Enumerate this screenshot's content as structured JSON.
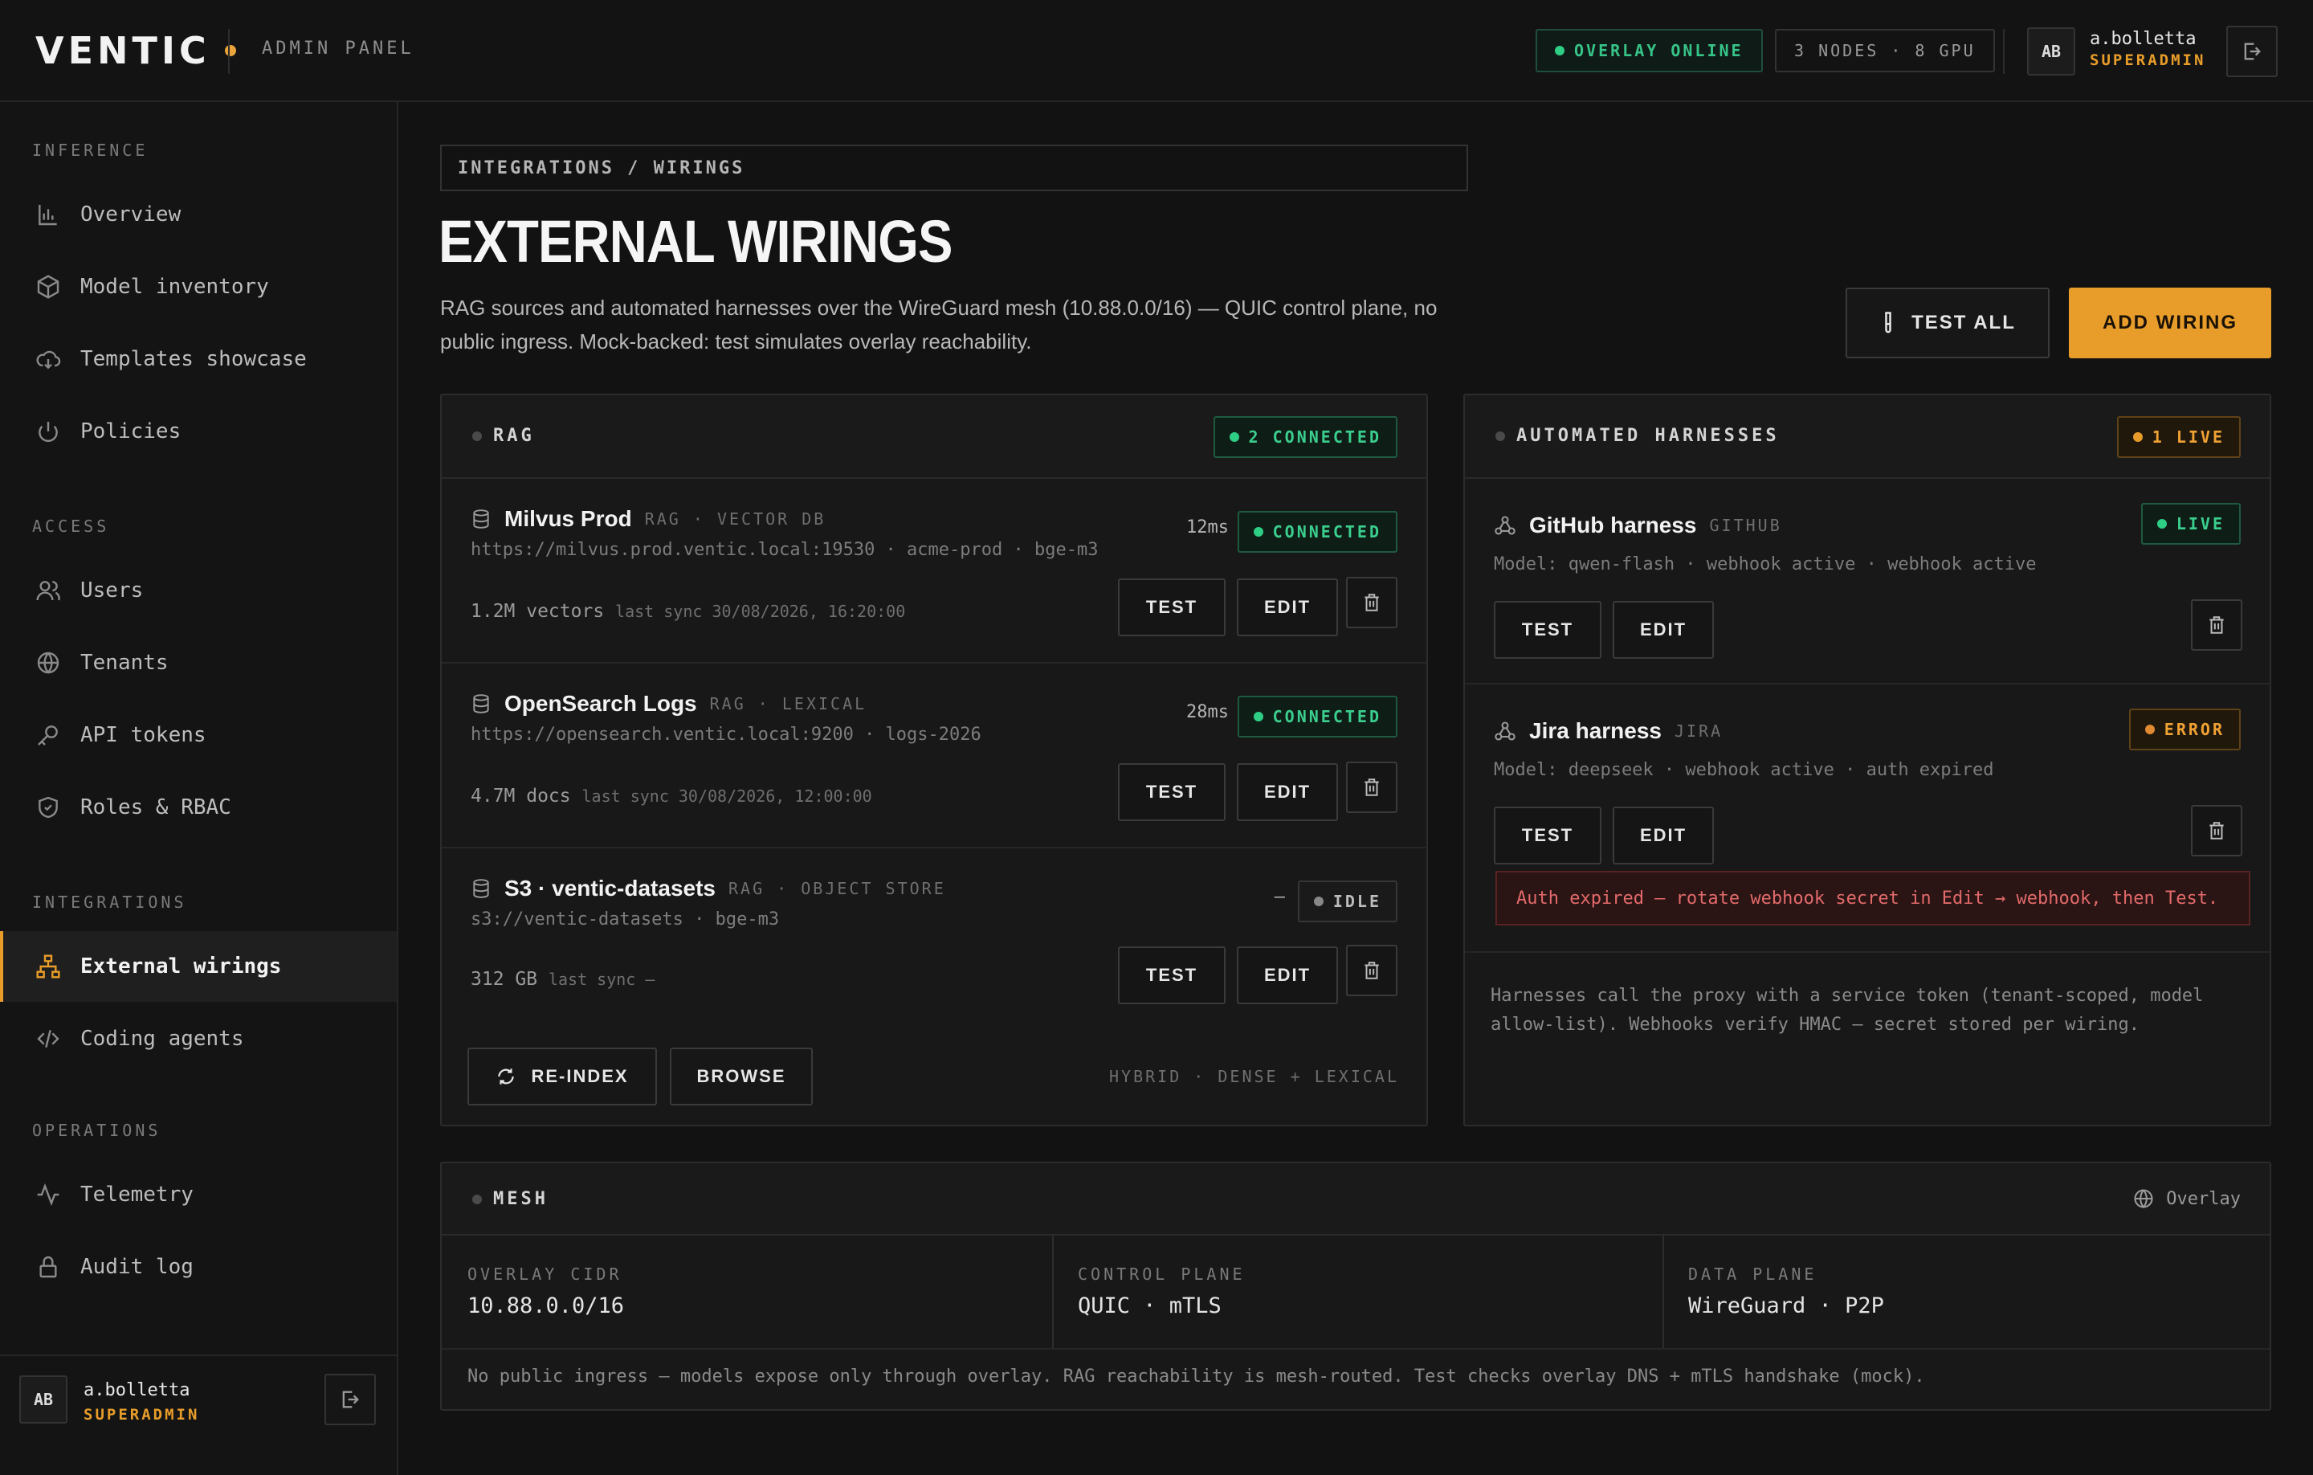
{
  "brand": {
    "logo": "VENTIC",
    "panel_label": "ADMIN PANEL",
    "accent": "#e89d2a",
    "success": "#36c488",
    "error": "#e36a6a"
  },
  "topbar": {
    "overlay_status": "OVERLAY ONLINE",
    "cluster": "3 NODES · 8 GPU",
    "user": {
      "initials": "AB",
      "name": "a.bolletta",
      "role": "SUPERADMIN"
    }
  },
  "sidebar": {
    "sections": [
      {
        "title": "INFERENCE",
        "items": [
          {
            "label": "Overview",
            "icon": "bar-chart-icon"
          },
          {
            "label": "Model inventory",
            "icon": "cube-icon"
          },
          {
            "label": "Templates showcase",
            "icon": "cloud-icon"
          },
          {
            "label": "Policies",
            "icon": "power-icon"
          }
        ]
      },
      {
        "title": "ACCESS",
        "items": [
          {
            "label": "Users",
            "icon": "users-icon"
          },
          {
            "label": "Tenants",
            "icon": "globe-icon"
          },
          {
            "label": "API tokens",
            "icon": "key-icon"
          },
          {
            "label": "Roles & RBAC",
            "icon": "shield-icon"
          }
        ]
      },
      {
        "title": "INTEGRATIONS",
        "items": [
          {
            "label": "External wirings",
            "icon": "network-icon",
            "active": true
          },
          {
            "label": "Coding agents",
            "icon": "code-icon"
          }
        ]
      },
      {
        "title": "OPERATIONS",
        "items": [
          {
            "label": "Telemetry",
            "icon": "pulse-icon"
          },
          {
            "label": "Audit log",
            "icon": "lock-icon"
          }
        ]
      }
    ],
    "footer": {
      "initials": "AB",
      "name": "a.bolletta",
      "role": "SUPERADMIN"
    }
  },
  "page": {
    "breadcrumb": "INTEGRATIONS / WIRINGS",
    "title": "EXTERNAL WIRINGS",
    "description": "RAG sources and automated harnesses over the WireGuard mesh (10.88.0.0/16) — QUIC control plane, no public ingress. Mock-backed: test simulates overlay reachability.",
    "test_all": "TEST ALL",
    "add_wiring": "ADD WIRING"
  },
  "rag": {
    "title": "RAG",
    "status": "2 CONNECTED",
    "test": "TEST",
    "edit": "EDIT",
    "items": [
      {
        "name": "Milvus Prod",
        "tag": "RAG · VECTOR DB",
        "url": "https://milvus.prod.ventic.local:19530 · acme-prod · bge-m3",
        "latency": "12ms",
        "status": "CONNECTED",
        "count": "1.2M vectors",
        "sync": "last sync 30/08/2026, 16:20:00"
      },
      {
        "name": "OpenSearch Logs",
        "tag": "RAG · LEXICAL",
        "url": "https://opensearch.ventic.local:9200 · logs-2026",
        "latency": "28ms",
        "status": "CONNECTED",
        "count": "4.7M docs",
        "sync": "last sync 30/08/2026, 12:00:00"
      },
      {
        "name": "S3 · ventic-datasets",
        "tag": "RAG · OBJECT STORE",
        "url": "s3://ventic-datasets · bge-m3",
        "latency": "—",
        "status": "IDLE",
        "count": "312 GB",
        "sync": "last sync —"
      }
    ],
    "reindex": "RE-INDEX",
    "browse": "BROWSE",
    "mode": "HYBRID · DENSE + LEXICAL"
  },
  "harnesses": {
    "title": "AUTOMATED HARNESSES",
    "status": "1 LIVE",
    "test": "TEST",
    "edit": "EDIT",
    "items": [
      {
        "name": "GitHub harness",
        "tag": "GITHUB",
        "meta": "Model: qwen-flash · webhook active · webhook active",
        "status": "LIVE"
      },
      {
        "name": "Jira harness",
        "tag": "JIRA",
        "meta": "Model: deepseek · webhook active · auth expired",
        "status": "ERROR",
        "error": "Auth expired — rotate webhook secret in Edit → webhook, then Test."
      }
    ],
    "note": "Harnesses call the proxy with a service token (tenant-scoped, model allow-list). Webhooks verify HMAC — secret stored per wiring."
  },
  "mesh": {
    "title": "MESH",
    "overlay": "Overlay",
    "cells": [
      {
        "label": "OVERLAY CIDR",
        "value": "10.88.0.0/16"
      },
      {
        "label": "CONTROL PLANE",
        "value": "QUIC · mTLS"
      },
      {
        "label": "DATA PLANE",
        "value": "WireGuard · P2P"
      }
    ],
    "note": "No public ingress — models expose only through overlay. RAG reachability is mesh-routed. Test checks overlay DNS + mTLS handshake (mock)."
  }
}
